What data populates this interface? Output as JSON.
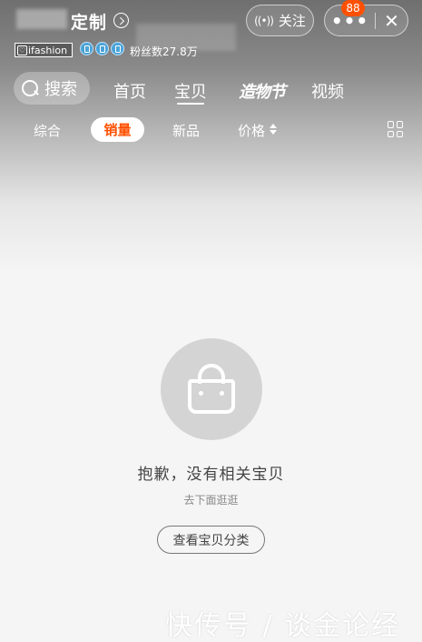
{
  "header": {
    "shop_name_suffix": "定制",
    "follow_label": "关注",
    "more_label": "•••",
    "close_label": "✕",
    "badge_count": "88"
  },
  "shop_meta": {
    "brand_tag": "ifashion",
    "fans_text": "粉丝数27.8万"
  },
  "nav": {
    "search_label": "搜索",
    "tabs": [
      "首页",
      "宝贝",
      "造物节",
      "视频"
    ],
    "active_tab": "宝贝"
  },
  "sort_bar": {
    "items": [
      "综合",
      "销量",
      "新品",
      "价格"
    ],
    "active": "销量"
  },
  "empty_state": {
    "title": "抱歉，没有相关宝贝",
    "subtitle": "去下面逛逛",
    "button_label": "查看宝贝分类"
  },
  "watermark": "快传号 / 谈金论经",
  "colors": {
    "accent": "#ff5000",
    "badge": "#ff5000",
    "empty_circle": "#d4d4d4"
  }
}
